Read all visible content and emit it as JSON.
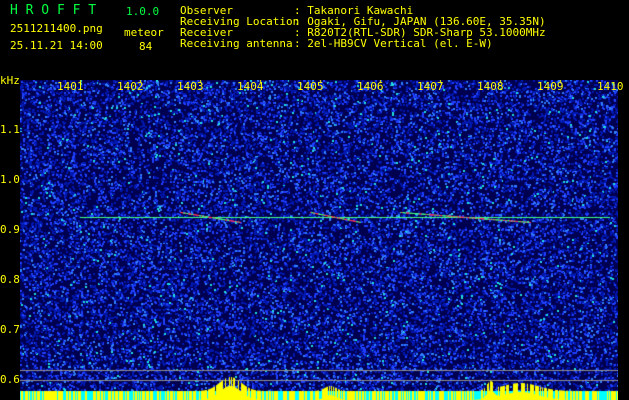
{
  "header": {
    "app_name": "H R O F F T",
    "version": "1.0.0",
    "filename": "2511211400.png",
    "datetime": "25.11.21 14:00",
    "meteor_label": "meteor",
    "meteor_count": "84"
  },
  "info": [
    {
      "label": "Observer",
      "value": ": Takanori Kawachi"
    },
    {
      "label": "Receiving Location",
      "value": ": Ogaki, Gifu, JAPAN (136.60E, 35.35N)"
    },
    {
      "label": "Receiver",
      "value": ": R820T2(RTL-SDR) SDR-Sharp 53.1000MHz"
    },
    {
      "label": "Receiving antenna",
      "value": ": 2el-HB9CV Vertical (el. E-W)"
    }
  ],
  "axis": {
    "y_unit": "kHz",
    "x_ticks": [
      "1401",
      "1402",
      "1403",
      "1404",
      "1405",
      "1406",
      "1407",
      "1408",
      "1409",
      "1410"
    ],
    "y_ticks": [
      "1.1",
      "1.0",
      "0.9",
      "0.8",
      "0.7",
      "0.6"
    ]
  },
  "colors": {
    "text": "#ffff00",
    "title": "#00ff40",
    "background": "#000080",
    "carrier": "#40ff80",
    "histogram": "#ffff00",
    "histogram_base": "#00ffff"
  }
}
